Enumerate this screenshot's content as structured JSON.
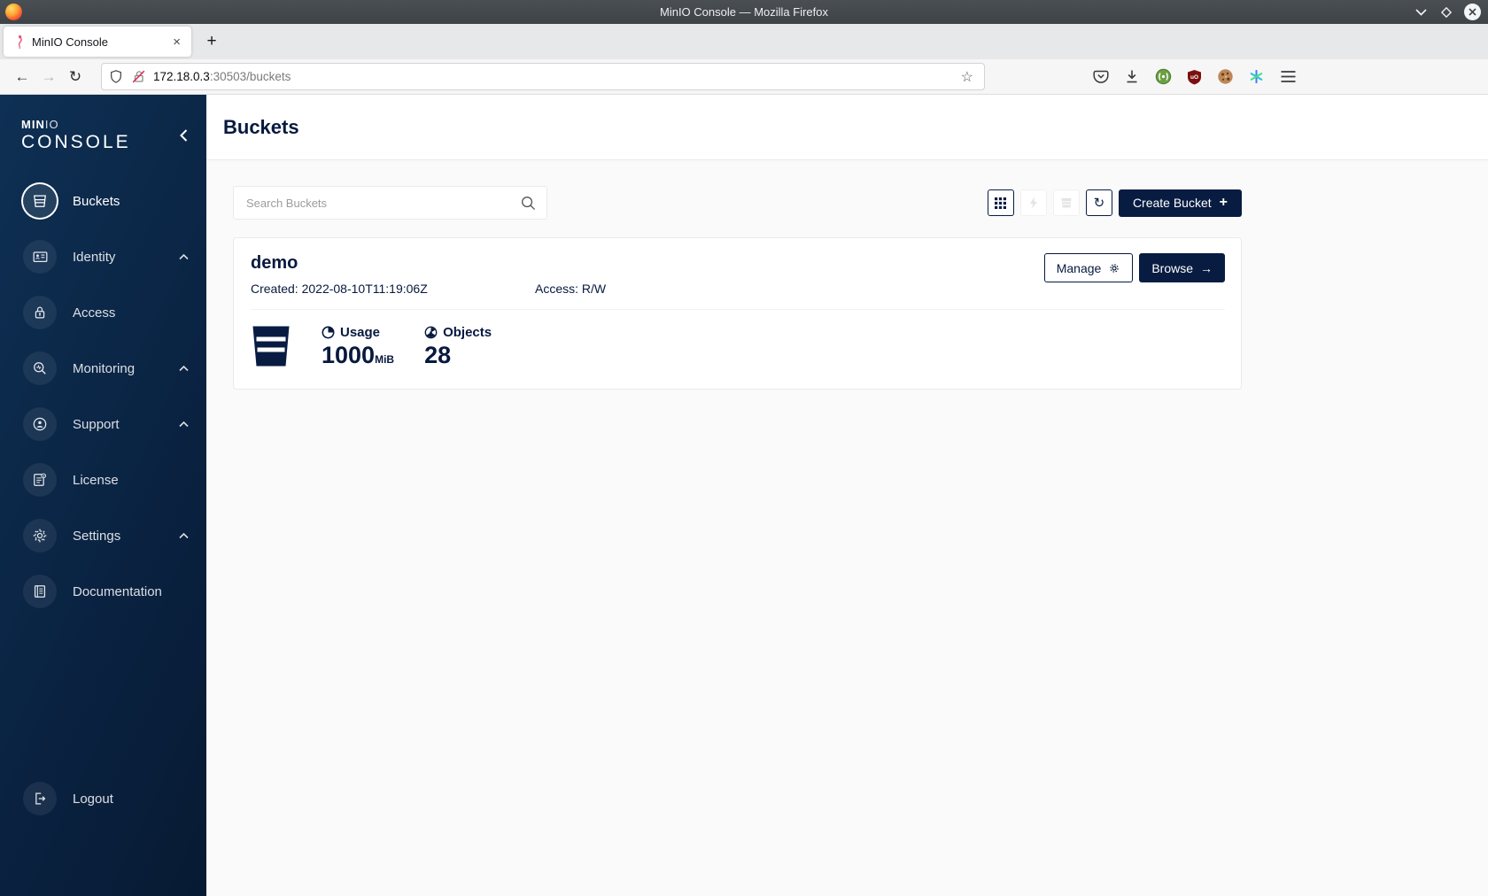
{
  "window": {
    "title": "MinIO Console — Mozilla Firefox"
  },
  "browser": {
    "tab_title": "MinIO Console",
    "url_host": "172.18.0.3",
    "url_rest": ":30503/buckets"
  },
  "icons": {
    "tab_close": "×",
    "new_tab": "+",
    "back": "←",
    "forward": "→",
    "reload": "↻",
    "star": "☆",
    "refresh": "↻",
    "plus": "+",
    "arrow_right": "→"
  },
  "sidebar": {
    "logo_min": "MIN",
    "logo_io": "IO",
    "logo_console": "CONSOLE",
    "items": [
      {
        "label": "Buckets"
      },
      {
        "label": "Identity"
      },
      {
        "label": "Access"
      },
      {
        "label": "Monitoring"
      },
      {
        "label": "Support"
      },
      {
        "label": "License"
      },
      {
        "label": "Settings"
      },
      {
        "label": "Documentation"
      }
    ],
    "logout_label": "Logout"
  },
  "main": {
    "page_title": "Buckets",
    "search_placeholder": "Search Buckets",
    "create_bucket_label": "Create Bucket",
    "bucket": {
      "name": "demo",
      "created": "Created: 2022-08-10T11:19:06Z",
      "access": "Access: R/W",
      "manage_label": "Manage",
      "browse_label": "Browse",
      "usage_label": "Usage",
      "usage_value": "1000",
      "usage_unit": "MiB",
      "objects_label": "Objects",
      "objects_value": "28"
    }
  },
  "colors": {
    "navy": "#081c42",
    "text_navy": "#07193e",
    "sidebar_top": "#0e3054",
    "sidebar_bottom": "#071a33",
    "titlebar": "#42474c",
    "page_bg": "#fafafa"
  }
}
